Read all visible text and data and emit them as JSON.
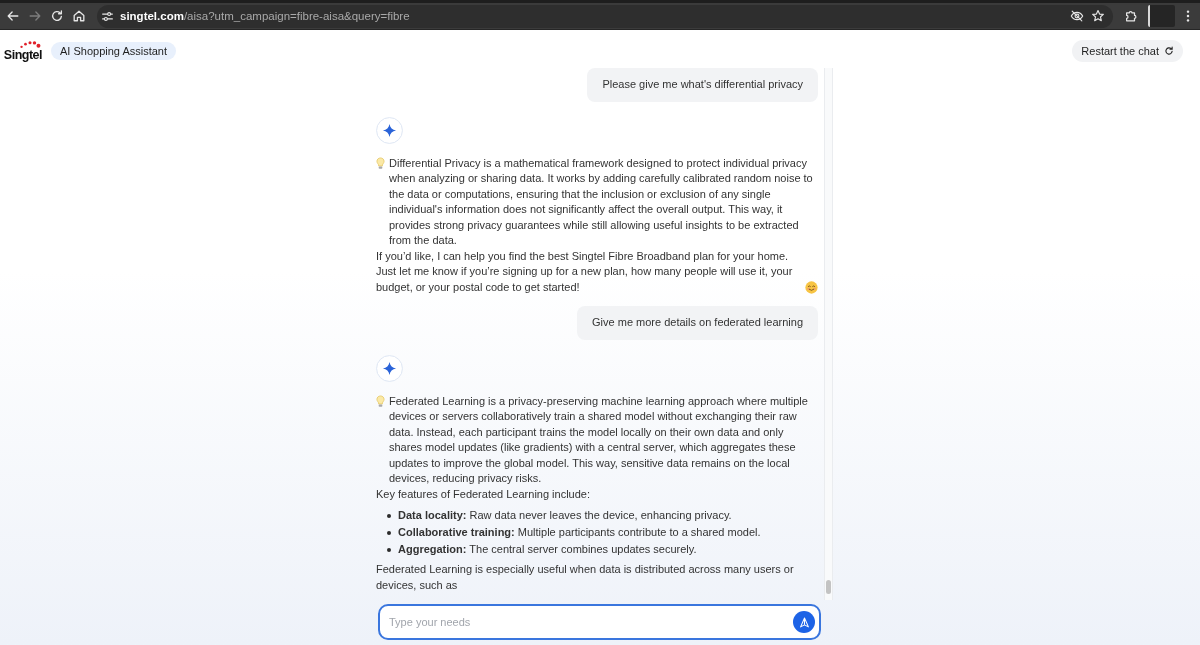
{
  "browser": {
    "nav_buttons": [
      {
        "kind": "back",
        "disabled": false
      },
      {
        "kind": "forward",
        "disabled": true
      },
      {
        "kind": "reload",
        "disabled": false
      },
      {
        "kind": "home",
        "disabled": false
      }
    ],
    "address_bar": {
      "host": "singtel.com",
      "path": "/aisa?utm_campaign=fibre-aisa&query=fibre"
    }
  },
  "header": {
    "logo": "Singtel",
    "badge": "AI Shopping Assistant",
    "restart_button": "Restart the chat"
  },
  "messages": [
    {
      "kind": "user",
      "text": "Please give me what's differential privacy"
    },
    {
      "kind": "assistant",
      "blocks": [
        {
          "kind": "tip",
          "text": "Differential Privacy is a mathematical framework designed to protect individual privacy when analyzing or sharing data. It works by adding carefully calibrated random noise to the data or computations, ensuring that the inclusion or exclusion of any single individual's information does not significantly affect the overall output. This way, it provides strong privacy guarantees while still allowing useful insights to be extracted from the data."
        },
        {
          "kind": "closing",
          "text": "If you’d like, I can help you find the best Singtel Fibre Broadband plan for your home. Just let me know if you’re signing up for a new plan, how many people will use it, your budget, or your postal code to get started!"
        }
      ]
    },
    {
      "kind": "user",
      "text": "Give me more details on federated learning"
    },
    {
      "kind": "assistant",
      "blocks": [
        {
          "kind": "tip",
          "text": "Federated Learning is a privacy-preserving machine learning approach where multiple devices or servers collaboratively train a shared model without exchanging their raw data. Instead, each participant trains the model locally on their own data and only shares model updates (like gradients) with a central server, which aggregates these updates to improve the global model. This way, sensitive data remains on the local devices, reducing privacy risks."
        },
        {
          "kind": "paragraph",
          "text": "Key features of Federated Learning include:"
        },
        {
          "kind": "list",
          "items": [
            "**Data locality:** Raw data never leaves the device, enhancing privacy.",
            "**Collaborative training:** Multiple participants contribute to a shared model.",
            "**Aggregation:** The central server combines updates securely."
          ]
        },
        {
          "kind": "paragraph",
          "text": "Federated Learning is especially useful when data is distributed across many users or devices, such as"
        }
      ]
    }
  ],
  "composer": {
    "placeholder": "Type your needs"
  }
}
